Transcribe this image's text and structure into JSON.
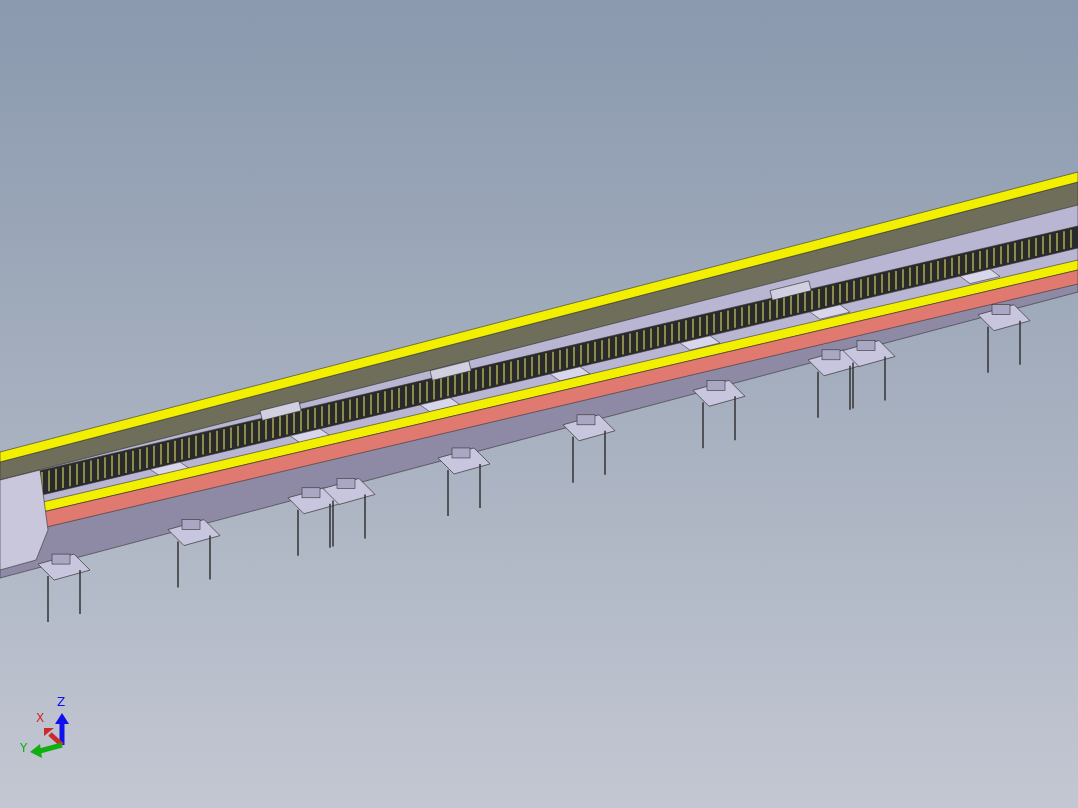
{
  "viewport": {
    "triad": {
      "axes": [
        {
          "label": "Z",
          "color": "#1010ee"
        },
        {
          "label": "X",
          "color": "#cc2a2a"
        },
        {
          "label": "Y",
          "color": "#10b010"
        }
      ]
    }
  }
}
